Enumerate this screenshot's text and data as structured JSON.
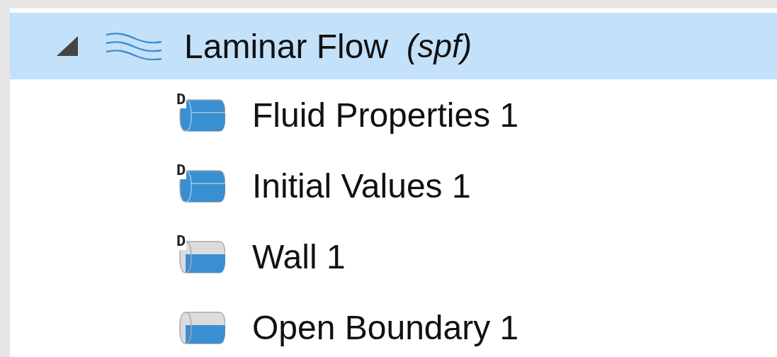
{
  "tree": {
    "label": "Laminar Flow",
    "tag": "(spf)",
    "expanded": true,
    "selected": true,
    "children": [
      {
        "label": "Fluid Properties 1",
        "kind": "domain",
        "badge": "D",
        "selected": false
      },
      {
        "label": "Initial Values 1",
        "kind": "domain",
        "badge": "D",
        "selected": false
      },
      {
        "label": "Wall 1",
        "kind": "boundary",
        "badge": "D",
        "selected": false
      },
      {
        "label": "Open Boundary 1",
        "kind": "boundary",
        "selected": false
      }
    ]
  }
}
